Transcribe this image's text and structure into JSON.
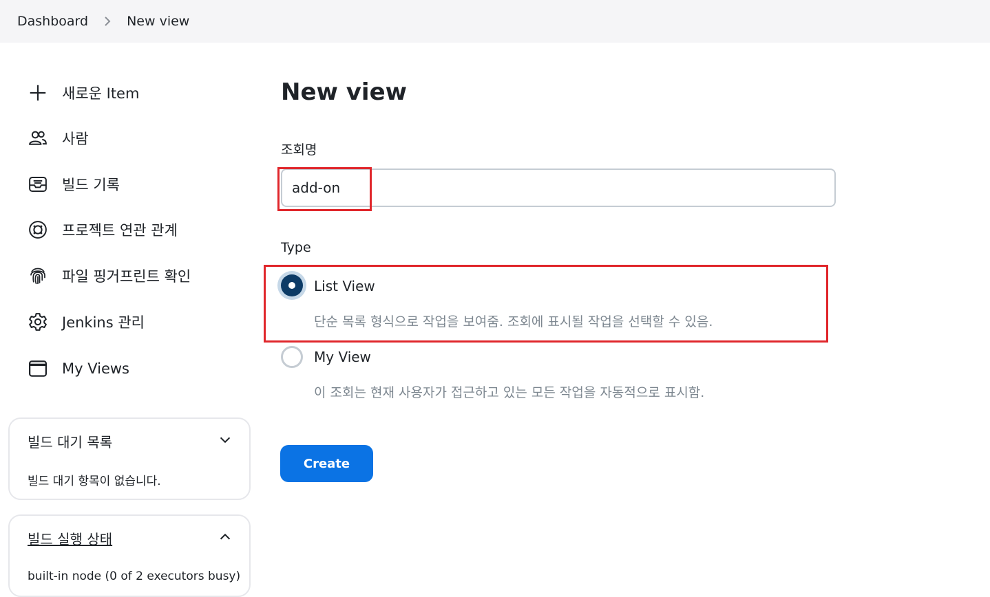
{
  "breadcrumb": {
    "items": [
      "Dashboard",
      "New view"
    ]
  },
  "sidebar": {
    "items": [
      {
        "label": "새로운 Item",
        "icon": "plus-icon"
      },
      {
        "label": "사람",
        "icon": "people-icon"
      },
      {
        "label": "빌드 기록",
        "icon": "inbox-icon"
      },
      {
        "label": "프로젝트 연관 관계",
        "icon": "relationship-icon"
      },
      {
        "label": "파일 핑거프린트 확인",
        "icon": "fingerprint-icon"
      },
      {
        "label": "Jenkins 관리",
        "icon": "gear-icon"
      },
      {
        "label": "My Views",
        "icon": "window-icon"
      }
    ],
    "build_queue": {
      "title": "빌드 대기 목록",
      "empty_text": "빌드 대기 항목이 없습니다.",
      "toggle_icon": "chevron-down-icon"
    },
    "executor_status": {
      "title": "빌드 실행 상태",
      "body": "built-in node (0 of 2 executors busy)",
      "toggle_icon": "chevron-up-icon"
    }
  },
  "main": {
    "title": "New view",
    "name_label": "조회명",
    "name_value": "add-on",
    "type_label": "Type",
    "options": [
      {
        "label": "List View",
        "description": "단순 목록 형식으로 작업을 보여줌. 조회에 표시될 작업을 선택할 수 있음.",
        "selected": true
      },
      {
        "label": "My View",
        "description": "이 조회는 현재 사용자가 접근하고 있는 모든 작업을 자동적으로 표시함.",
        "selected": false
      }
    ],
    "create_label": "Create"
  },
  "colors": {
    "accent": "#0b73e4",
    "radio_selected": "#0d3b66",
    "highlight": "#e0262b"
  }
}
